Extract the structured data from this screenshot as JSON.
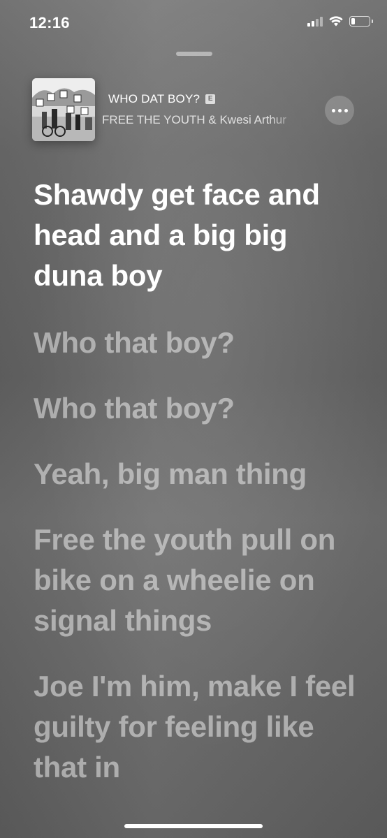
{
  "status_bar": {
    "time": "12:16",
    "icons": [
      "signal-icon",
      "wifi-icon",
      "battery-icon"
    ],
    "battery_level": 0.2
  },
  "now_playing": {
    "title": "WHO DAT BOY?",
    "explicit_badge": "E",
    "artist": "FREE THE YOUTH & Kwesi Arthur",
    "artwork_icon": "album-artwork",
    "more_icon": "ellipsis-icon"
  },
  "lyrics": [
    {
      "text": "Shawdy get face and head and a big big duna boy",
      "active": true
    },
    {
      "text": "Who that boy?",
      "active": false
    },
    {
      "text": "Who that boy?",
      "active": false
    },
    {
      "text": "Yeah, big man thing",
      "active": false
    },
    {
      "text": "Free the youth pull on bike on a wheelie on signal things",
      "active": false
    },
    {
      "text": "Joe I'm him, make I feel guilty for feeling like that in",
      "active": false
    }
  ],
  "colors": {
    "background": "#6a6a6a",
    "active_lyric": "#ffffff",
    "inactive_lyric": "rgba(255,255,255,0.48)"
  }
}
